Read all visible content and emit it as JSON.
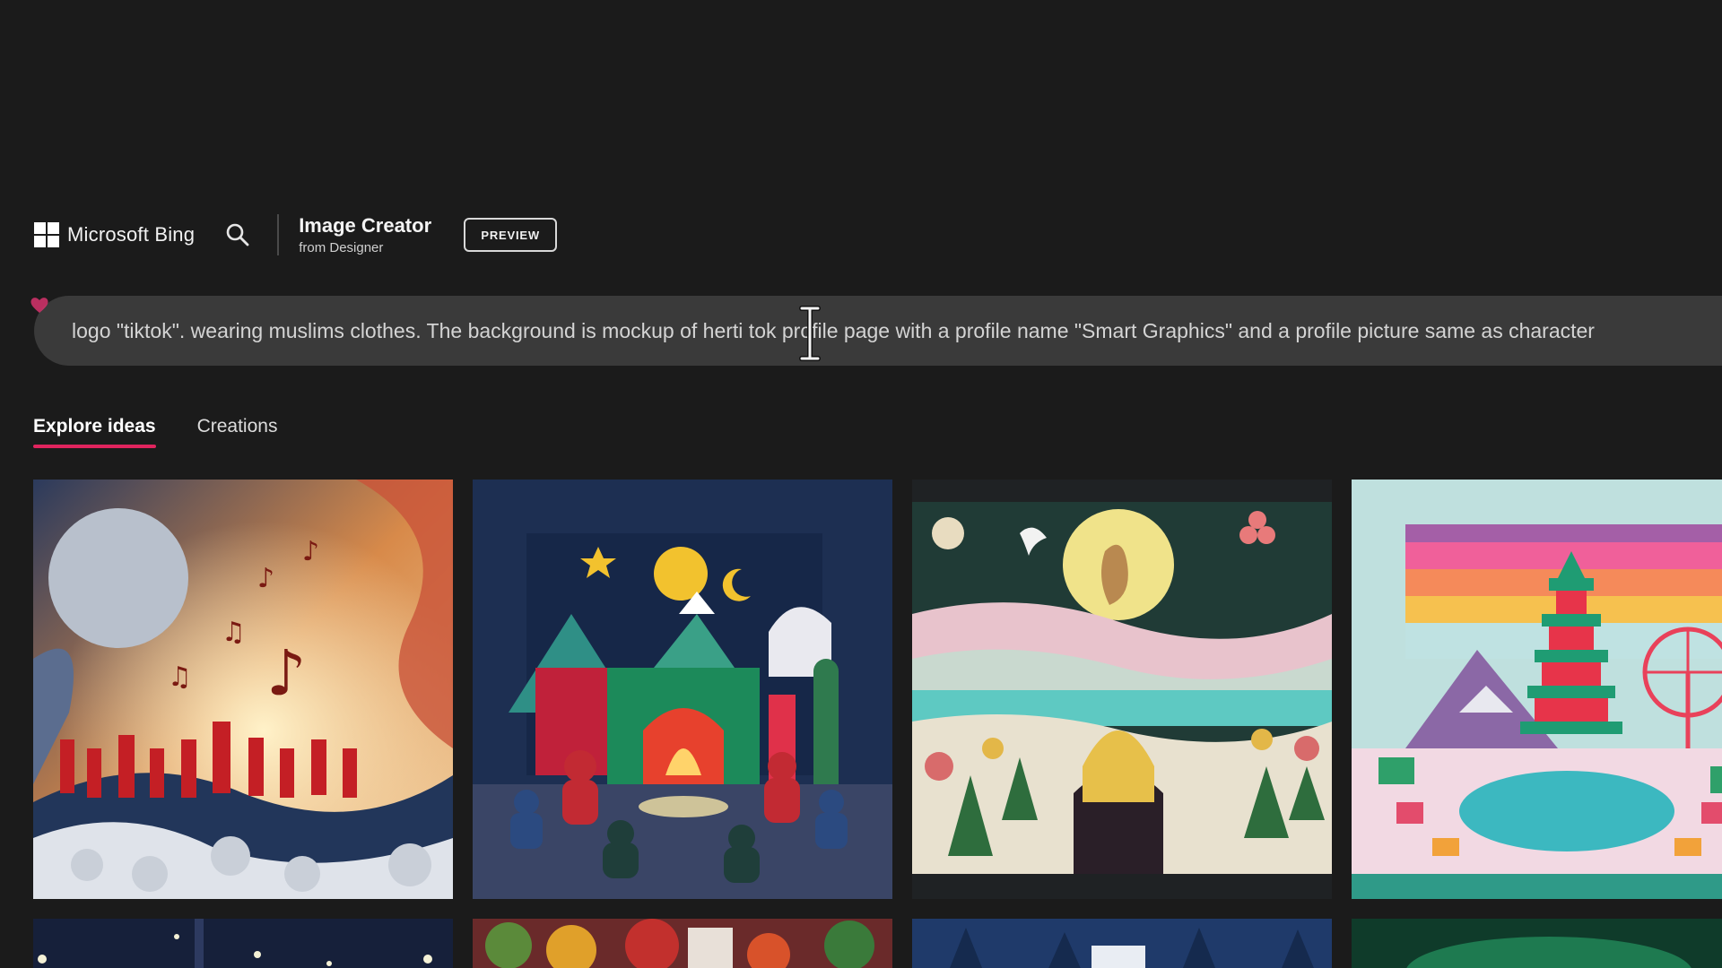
{
  "header": {
    "brand_name": "Microsoft Bing",
    "product_title": "Image Creator",
    "product_subtitle": "from Designer",
    "preview_label": "PREVIEW"
  },
  "prompt": {
    "value": "logo \"tiktok\". wearing muslims clothes. The background is mockup of herti tok profile page with a profile name \"Smart Graphics\" and a profile picture same as character"
  },
  "tabs": [
    {
      "label": "Explore ideas",
      "active": true
    },
    {
      "label": "Creations",
      "active": false
    }
  ],
  "colors": {
    "background": "#1b1b1b",
    "prompt_bar": "#3a3a3a",
    "tab_underline": "#e0245e",
    "heart": "#d6336c"
  },
  "icons": {
    "brand": "microsoft-logo-icon",
    "search": "search-icon",
    "prompt_heart": "heart-icon",
    "cursor": "text-cursor-icon"
  }
}
